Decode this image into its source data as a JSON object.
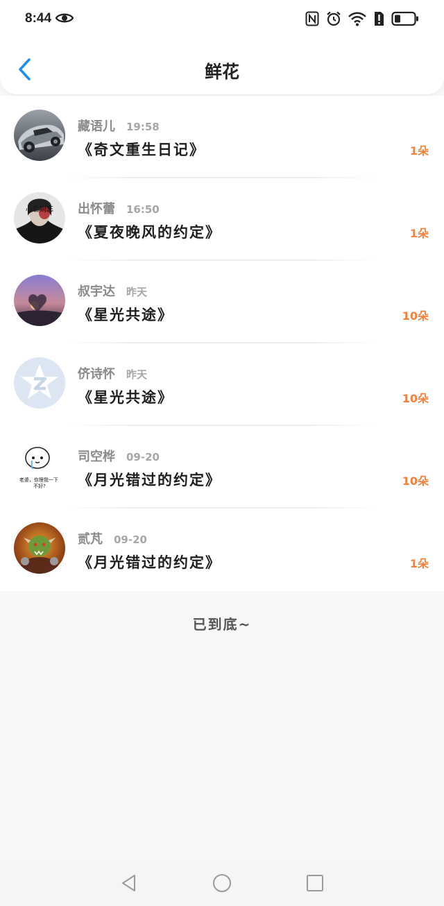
{
  "status_bar": {
    "time": "8:44"
  },
  "header": {
    "title": "鲜花"
  },
  "items": [
    {
      "user": "藏语儿",
      "time": "19:58",
      "book": "《奇文重生日记》",
      "count": "1朵"
    },
    {
      "user": "出怀蕾",
      "time": "16:50",
      "book": "《夏夜晚风的约定》",
      "count": "1朵"
    },
    {
      "user": "叔宇达",
      "time": "昨天",
      "book": "《星光共途》",
      "count": "10朵"
    },
    {
      "user": "侪诗怀",
      "time": "昨天",
      "book": "《星光共途》",
      "count": "10朵"
    },
    {
      "user": "司空桦",
      "time": "09-20",
      "book": "《月光错过的约定》",
      "count": "10朵"
    },
    {
      "user": "贰芃",
      "time": "09-20",
      "book": "《月光错过的约定》",
      "count": "1朵"
    }
  ],
  "avatars": {
    "item_1_overlay_text": "心亡则忘",
    "item_4_overlay_text": "老婆，你理我一下\n不好?"
  },
  "footer": {
    "end_text": "已到底~"
  },
  "colors": {
    "accent_blue": "#1a8ff0",
    "count_orange": "#f5813a",
    "title_text": "#1e1e1e",
    "meta_text": "#8a8a8a",
    "page_bg": "#f8f6f7"
  },
  "icons": {
    "back": "chevron-left-icon",
    "status_eye": "eye-icon",
    "status_nfc": "nfc-icon",
    "status_alarm": "alarm-icon",
    "status_wifi": "wifi-icon",
    "status_alert": "sim-alert-icon",
    "status_battery": "battery-icon",
    "nav_back": "triangle-back-icon",
    "nav_home": "circle-home-icon",
    "nav_recents": "square-recents-icon"
  }
}
